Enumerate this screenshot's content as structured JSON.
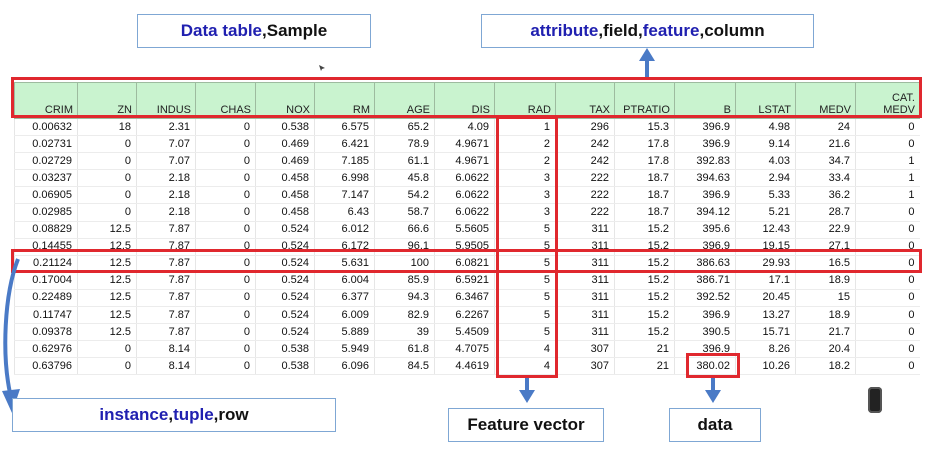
{
  "callouts": {
    "data_table": {
      "part1": "Data table",
      "sep": ", ",
      "part2": "Sample"
    },
    "attribute": {
      "part1": "attribute",
      "sep1": ", ",
      "part2": "field",
      "sep2": ", ",
      "part3": "feature",
      "sep3": ", ",
      "part4": "column"
    },
    "instance": {
      "part1": "instance",
      "sep1": ", ",
      "part2": "tuple",
      "sep2": ", ",
      "part3": "row"
    },
    "feature_vector": "Feature vector",
    "data": "data"
  },
  "colors": {
    "highlight_text": "#2020b0",
    "red_box": "#e0282e",
    "arrow": "#4a7ac6",
    "header_bg": "#c9f3cf"
  },
  "table": {
    "headers": [
      "CRIM",
      "ZN",
      "INDUS",
      "CHAS",
      "NOX",
      "RM",
      "AGE",
      "DIS",
      "RAD",
      "TAX",
      "PTRATIO",
      "B",
      "LSTAT",
      "MEDV",
      "CAT. MEDV"
    ],
    "rows": [
      [
        "0.00632",
        "18",
        "2.31",
        "0",
        "0.538",
        "6.575",
        "65.2",
        "4.09",
        "1",
        "296",
        "15.3",
        "396.9",
        "4.98",
        "24",
        "0"
      ],
      [
        "0.02731",
        "0",
        "7.07",
        "0",
        "0.469",
        "6.421",
        "78.9",
        "4.9671",
        "2",
        "242",
        "17.8",
        "396.9",
        "9.14",
        "21.6",
        "0"
      ],
      [
        "0.02729",
        "0",
        "7.07",
        "0",
        "0.469",
        "7.185",
        "61.1",
        "4.9671",
        "2",
        "242",
        "17.8",
        "392.83",
        "4.03",
        "34.7",
        "1"
      ],
      [
        "0.03237",
        "0",
        "2.18",
        "0",
        "0.458",
        "6.998",
        "45.8",
        "6.0622",
        "3",
        "222",
        "18.7",
        "394.63",
        "2.94",
        "33.4",
        "1"
      ],
      [
        "0.06905",
        "0",
        "2.18",
        "0",
        "0.458",
        "7.147",
        "54.2",
        "6.0622",
        "3",
        "222",
        "18.7",
        "396.9",
        "5.33",
        "36.2",
        "1"
      ],
      [
        "0.02985",
        "0",
        "2.18",
        "0",
        "0.458",
        "6.43",
        "58.7",
        "6.0622",
        "3",
        "222",
        "18.7",
        "394.12",
        "5.21",
        "28.7",
        "0"
      ],
      [
        "0.08829",
        "12.5",
        "7.87",
        "0",
        "0.524",
        "6.012",
        "66.6",
        "5.5605",
        "5",
        "311",
        "15.2",
        "395.6",
        "12.43",
        "22.9",
        "0"
      ],
      [
        "0.14455",
        "12.5",
        "7.87",
        "0",
        "0.524",
        "6.172",
        "96.1",
        "5.9505",
        "5",
        "311",
        "15.2",
        "396.9",
        "19.15",
        "27.1",
        "0"
      ],
      [
        "0.21124",
        "12.5",
        "7.87",
        "0",
        "0.524",
        "5.631",
        "100",
        "6.0821",
        "5",
        "311",
        "15.2",
        "386.63",
        "29.93",
        "16.5",
        "0"
      ],
      [
        "0.17004",
        "12.5",
        "7.87",
        "0",
        "0.524",
        "6.004",
        "85.9",
        "6.5921",
        "5",
        "311",
        "15.2",
        "386.71",
        "17.1",
        "18.9",
        "0"
      ],
      [
        "0.22489",
        "12.5",
        "7.87",
        "0",
        "0.524",
        "6.377",
        "94.3",
        "6.3467",
        "5",
        "311",
        "15.2",
        "392.52",
        "20.45",
        "15",
        "0"
      ],
      [
        "0.11747",
        "12.5",
        "7.87",
        "0",
        "0.524",
        "6.009",
        "82.9",
        "6.2267",
        "5",
        "311",
        "15.2",
        "396.9",
        "13.27",
        "18.9",
        "0"
      ],
      [
        "0.09378",
        "12.5",
        "7.87",
        "0",
        "0.524",
        "5.889",
        "39",
        "5.4509",
        "5",
        "311",
        "15.2",
        "390.5",
        "15.71",
        "21.7",
        "0"
      ],
      [
        "0.62976",
        "0",
        "8.14",
        "0",
        "0.538",
        "5.949",
        "61.8",
        "4.7075",
        "4",
        "307",
        "21",
        "396.9",
        "8.26",
        "20.4",
        "0"
      ],
      [
        "0.63796",
        "0",
        "8.14",
        "0",
        "0.538",
        "6.096",
        "84.5",
        "4.4619",
        "4",
        "307",
        "21",
        "380.02",
        "10.26",
        "18.2",
        "0"
      ]
    ]
  }
}
